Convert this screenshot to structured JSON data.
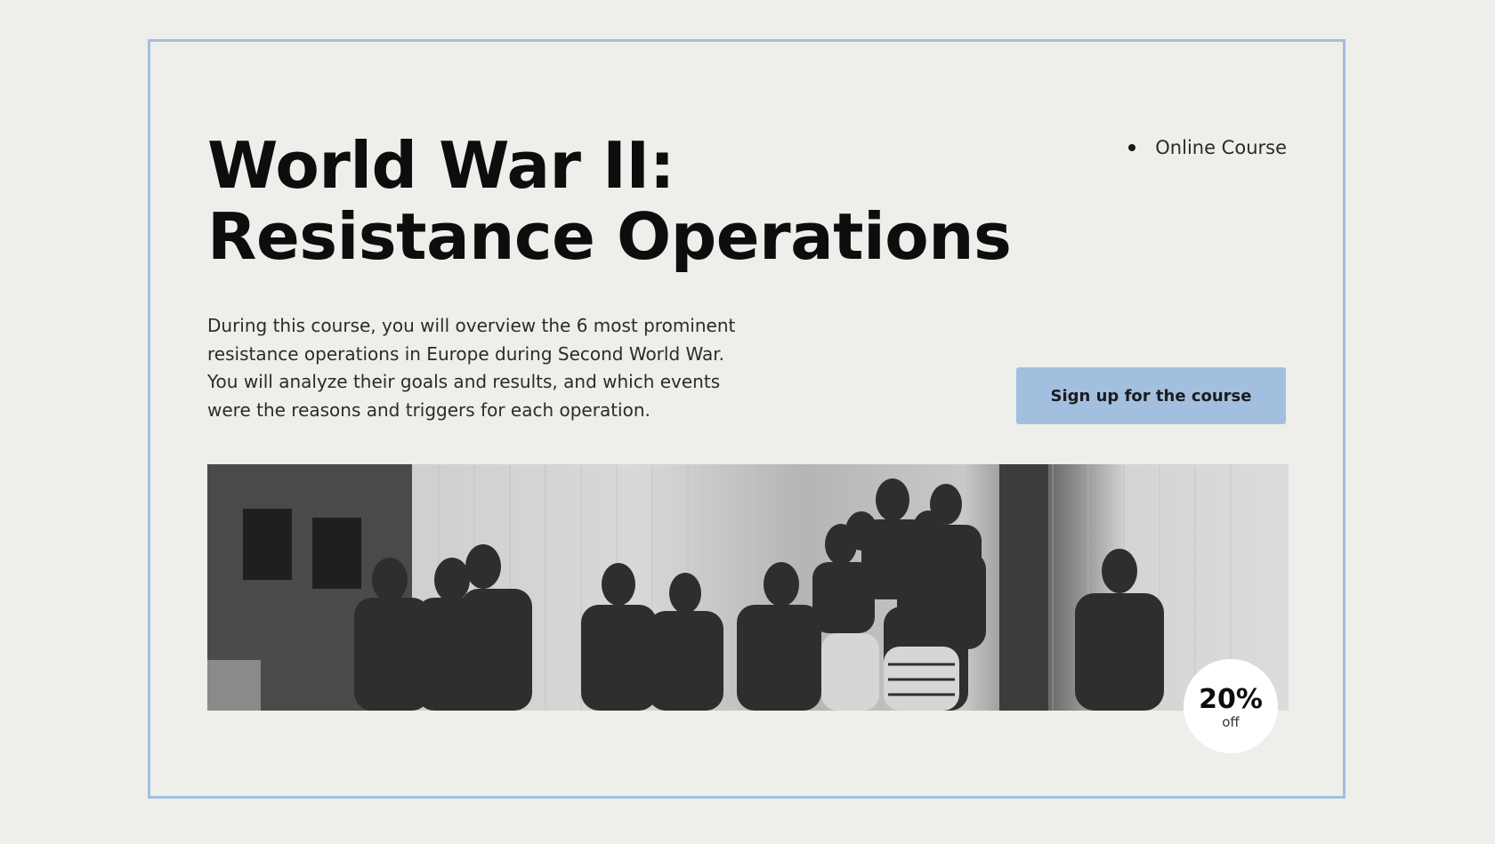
{
  "course": {
    "title_line1": "World War II:",
    "title_line2": "Resistance Operations",
    "tag": "Online Course",
    "description": "During this course, you will overview the 6 most prominent resistance operations in Europe during Second World War. You will analyze their goals and results, and which events were the reasons and triggers for each operation.",
    "cta_label": "Sign up for the course"
  },
  "discount": {
    "percent": "20%",
    "label": "off"
  },
  "colors": {
    "background": "#eeeeea",
    "accent": "#a3bfe0",
    "text": "#0d0d0d"
  }
}
